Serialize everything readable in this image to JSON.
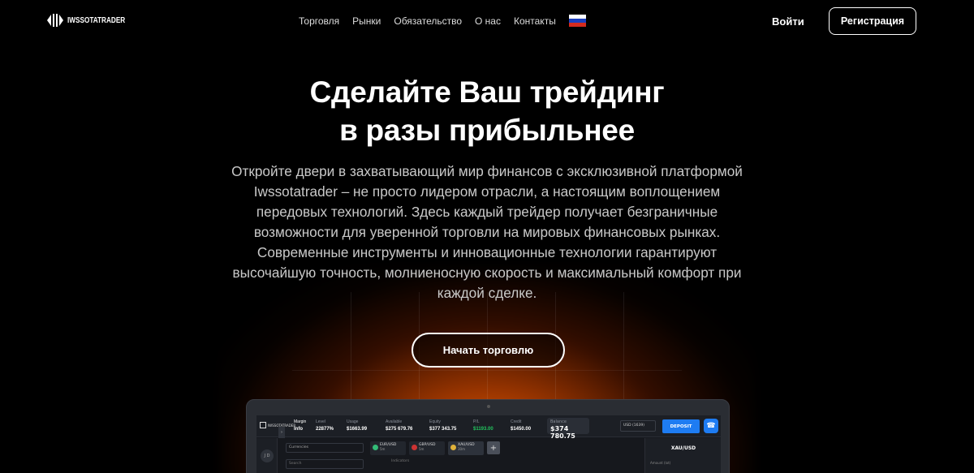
{
  "header": {
    "logo_text": "IWSSOTATRADER",
    "nav": [
      "Торговля",
      "Рынки",
      "Обязательство",
      "О нас",
      "Контакты"
    ],
    "language_flag": "russia-flag-icon",
    "login_label": "Войти",
    "register_label": "Регистрация"
  },
  "hero": {
    "title_line1": "Сделайте Ваш трейдинг",
    "title_line2": "в разы прибыльнее",
    "description": "Откройте двери в захватывающий мир финансов с эксклюзивной платформой Iwssotatrader – не просто лидером отрасли, а настоящим воплощением передовых технологий. Здесь каждый трейдер получает безграничные возможности для уверенной торговли на мировых финансовых рынках. Современные инструменты и инновационные технологии гарантируют высочайшую точность, молниеносную скорость и максимальный комфорт при каждой сделке.",
    "cta_label": "Начать торговлю"
  },
  "platform": {
    "logo_text": "IWSSOTATRADER",
    "stats": [
      {
        "label": "Margin",
        "value": "Info"
      },
      {
        "label": "Level",
        "value": "22877%"
      },
      {
        "label": "Usage",
        "value": "$1663.99"
      },
      {
        "label": "Available",
        "value": "$275 679.76"
      },
      {
        "label": "Equity",
        "value": "$377 343.75"
      },
      {
        "label": "P/L",
        "value": "$1193.00"
      },
      {
        "label": "Credit",
        "value": "$1450.00"
      }
    ],
    "balance_label": "Balance",
    "balance_value": "$374 780.75",
    "account_select": "USD (1639)",
    "deposit_label": "DEPOSIT",
    "avatar_initials": "J D",
    "currencies_select": "Currencies",
    "search_placeholder": "Search",
    "tabs": [
      {
        "symbol": "EUR/USD",
        "tf": "5m"
      },
      {
        "symbol": "GBP/USD",
        "tf": "5m"
      },
      {
        "symbol": "XAU/USD",
        "tf": "30m"
      }
    ],
    "indicators_label": "Indicators",
    "right_title": "XAU/USD",
    "amount_label": "Amount (lot)"
  },
  "colors": {
    "accent_blue": "#1e7cf2",
    "glow_orange": "#ff7a00",
    "pl_green": "#22c55e"
  }
}
